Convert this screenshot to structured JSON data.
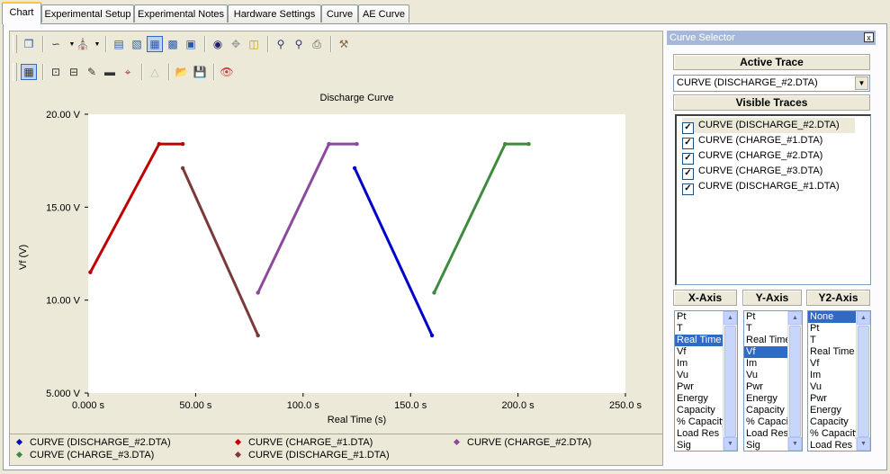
{
  "tabs": [
    "Chart",
    "Experimental Setup",
    "Experimental Notes",
    "Hardware Settings",
    "Curve",
    "AE Curve"
  ],
  "active_tab": "Chart",
  "selector": {
    "title": "Curve Selector",
    "close_label": "x",
    "active_trace_label": "Active Trace",
    "active_trace_value": "CURVE (DISCHARGE_#2.DTA)",
    "visible_traces_label": "Visible Traces",
    "visible_traces": [
      "CURVE (DISCHARGE_#2.DTA)",
      "CURVE (CHARGE_#1.DTA)",
      "CURVE (CHARGE_#2.DTA)",
      "CURVE (CHARGE_#3.DTA)",
      "CURVE (DISCHARGE_#1.DTA)"
    ],
    "x_axis_label": "X-Axis",
    "y_axis_label": "Y-Axis",
    "y2_axis_label": "Y2-Axis",
    "x_axis_options": [
      "Pt",
      "T",
      "Real Time",
      "Vf",
      "Im",
      "Vu",
      "Pwr",
      "Energy",
      "Capacity",
      "% Capacity",
      "Load Res",
      "Sig"
    ],
    "x_axis_selected": "Real Time",
    "y_axis_options": [
      "Pt",
      "T",
      "Real Time",
      "Vf",
      "Im",
      "Vu",
      "Pwr",
      "Energy",
      "Capacity",
      "% Capacity",
      "Load Res",
      "Sig"
    ],
    "y_axis_selected": "Vf",
    "y2_axis_options": [
      "None",
      "Pt",
      "T",
      "Real Time",
      "Vf",
      "Im",
      "Vu",
      "Pwr",
      "Energy",
      "Capacity",
      "% Capacity",
      "Load Res"
    ],
    "y2_axis_selected": "None"
  },
  "chart_data": {
    "type": "line",
    "title": "Discharge Curve",
    "xlabel": "Real Time (s)",
    "ylabel": "Vf (V)",
    "xlim": [
      0,
      250
    ],
    "ylim": [
      5,
      20
    ],
    "x_ticks": [
      "0.000 s",
      "50.00 s",
      "100.0 s",
      "150.0 s",
      "200.0 s",
      "250.0 s"
    ],
    "y_ticks": [
      "5.000 V",
      "10.00 V",
      "15.00 V",
      "20.00 V"
    ],
    "grid": false,
    "legend_position": "bottom",
    "series": [
      {
        "name": "CURVE (DISCHARGE_#2.DTA)",
        "color": "#0000cc",
        "x": [
          124,
          160
        ],
        "y": [
          17.1,
          8.1
        ]
      },
      {
        "name": "CURVE (CHARGE_#1.DTA)",
        "color": "#c00000",
        "x": [
          1,
          33,
          44
        ],
        "y": [
          11.5,
          18.4,
          18.4
        ]
      },
      {
        "name": "CURVE (CHARGE_#2.DTA)",
        "color": "#8b4a9c",
        "x": [
          79,
          112,
          125
        ],
        "y": [
          10.4,
          18.4,
          18.4
        ]
      },
      {
        "name": "CURVE (CHARGE_#3.DTA)",
        "color": "#3f8a3f",
        "x": [
          161,
          194,
          205
        ],
        "y": [
          10.4,
          18.4,
          18.4
        ]
      },
      {
        "name": "CURVE (DISCHARGE_#1.DTA)",
        "color": "#7a3a3a",
        "x": [
          44,
          79
        ],
        "y": [
          17.1,
          8.1
        ]
      }
    ]
  }
}
